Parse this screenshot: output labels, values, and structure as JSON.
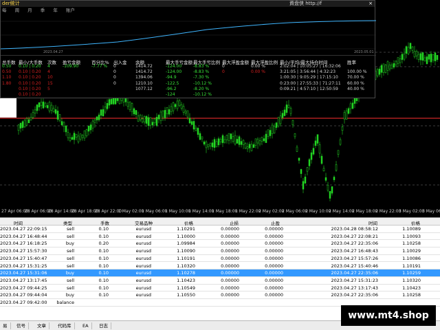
{
  "stats_window": {
    "title": "der统计",
    "right_title": "資盘侠 http://f",
    "menu": [
      "每",
      "周",
      "月",
      "季",
      "年",
      "账户"
    ],
    "close_label": "×",
    "balance_label_left": "2023.04.27",
    "balance_label_right": "2023.05.01",
    "headers": [
      "总手数",
      "最小/大手数",
      "次数",
      "盈亏金额",
      "百分比%",
      "出入金",
      "余额",
      "最大手亏金额",
      "最大手亏比例",
      "最大浮盈金额",
      "最大浮盈比例",
      "最小/平均/最大持仓时间",
      "胜率"
    ],
    "rows": [
      {
        "color": "#39e639",
        "cells": [
          "0.50",
          "0.10 | 0.20",
          "4",
          "-109.90",
          "-7.77 %",
          "0",
          "1414.72",
          "-124.00",
          "-8.83 %",
          "0",
          "0.00 %",
          "2:02:04 | 10:05:27 | 16:32:06",
          ""
        ]
      },
      {
        "color": "#d62020",
        "cells": [
          "0.50",
          "0.10 | 0.20",
          "4",
          "",
          "",
          "0",
          "1414.72",
          "-124.00",
          "-8.83 %",
          "0",
          "0.00 %",
          "3:21:05 | 3:56:44 | 4:32:23",
          "100.00 %"
        ]
      },
      {
        "color": "#d62020",
        "cells": [
          "1.10",
          "0.10 | 0.20",
          "10",
          "",
          "",
          "0",
          "1394.06",
          "-94.9",
          "-7.30 %",
          "",
          "",
          "1:00:30 | 9:05:29 | 17:15:10",
          "70.00 %"
        ]
      },
      {
        "color": "#d62020",
        "cells": [
          "1.80",
          "0.10 | 0.20",
          "15",
          "",
          "",
          "0",
          "1210.10",
          "-122.5",
          "-10.12 %",
          "",
          "",
          "0:23:00 | 27:55:33 | 71:27:11",
          "60.00 %"
        ]
      },
      {
        "color": "#d62020",
        "cells": [
          "",
          "0.10 | 0.20",
          "5",
          "",
          "",
          "",
          "1077.12",
          "-96.2",
          "-8.20 %",
          "",
          "",
          "0:09:21 | 4:57:10 | 12:50:59",
          "40.00 %"
        ]
      },
      {
        "color": "#d62020",
        "cells": [
          "",
          "0.10 | 0.20",
          "",
          "",
          "",
          "",
          "",
          "-124",
          "-10.12 %",
          "",
          "",
          "",
          ""
        ]
      }
    ]
  },
  "chart": {
    "x_labels": [
      "27 Apr 06:00",
      "28 Apr 06:00",
      "28 Apr 14:00",
      "28 Apr 18:00",
      "28 Apr 22:00",
      "1 May 02:00",
      "1 May 06:00",
      "1 May 10:00",
      "1 May 14:00",
      "1 May 18:00",
      "1 May 22:00",
      "2 May 02:00",
      "2 May 06:00",
      "2 May 10:00",
      "2 May 14:00",
      "2 May 18:00",
      "2 May 22:00",
      "3 May 02:00",
      "3 May 06:00"
    ],
    "colors": {
      "candle": "#22d422",
      "balance_line": "#3fb6ff",
      "red_line": "#ff3030"
    }
  },
  "history": {
    "headers": [
      "时间",
      "类型",
      "手数",
      "交易品种",
      "价格",
      "止损",
      "止盈",
      "时间",
      "价格"
    ],
    "rows": [
      [
        "2023.04.27 22:09:15",
        "sell",
        "0.10",
        "eurusd",
        "1.10291",
        "0.00000",
        "0.00000",
        "2023.04.28 08:58:12",
        "1.10089"
      ],
      [
        "2023.04.27 16:48:44",
        "sell",
        "0.10",
        "eurusd",
        "1.10000",
        "0.00000",
        "0.00000",
        "2023.04.27 22:08:21",
        "1.10093"
      ],
      [
        "2023.04.27 16:18:25",
        "buy",
        "0.20",
        "eurusd",
        "1.09984",
        "0.00000",
        "0.00000",
        "2023.04.27 22:35:06",
        "1.10258"
      ],
      [
        "2023.04.27 15:57:30",
        "sell",
        "0.10",
        "eurusd",
        "1.10090",
        "0.00000",
        "0.00000",
        "2023.04.27 16:48:43",
        "1.10029"
      ],
      [
        "2023.04.27 15:40:47",
        "sell",
        "0.10",
        "eurusd",
        "1.10191",
        "0.00000",
        "0.00000",
        "2023.04.27 15:57:26",
        "1.10086"
      ],
      [
        "2023.04.27 15:31:25",
        "sell",
        "0.10",
        "eurusd",
        "1.10320",
        "0.00000",
        "0.00000",
        "2023.04.27 15:40:46",
        "1.10191"
      ],
      [
        "2023.04.27 15:31:06",
        "buy",
        "0.10",
        "eurusd",
        "1.10278",
        "0.00000",
        "0.00000",
        "2023.04.27 22:35:06",
        "1.10259"
      ],
      [
        "2023.04.27 13:17:45",
        "sell",
        "0.10",
        "eurusd",
        "1.10423",
        "0.00000",
        "0.00000",
        "2023.04.27 15:31:23",
        "1.10320"
      ],
      [
        "2023.04.27 09:44:25",
        "sell",
        "0.10",
        "eurusd",
        "1.10549",
        "0.00000",
        "0.00000",
        "2023.04.27 13:17:43",
        "1.10423"
      ],
      [
        "2023.04.27 09:44:04",
        "buy",
        "0.10",
        "eurusd",
        "1.10550",
        "0.00000",
        "0.00000",
        "2023.04.27 22:35:06",
        "1.10258"
      ],
      [
        "2023.04.27 09:42:00",
        "balance",
        "",
        "",
        "",
        "",
        "",
        "",
        ""
      ]
    ],
    "selected_index": 6
  },
  "tabs": [
    "易",
    "信号",
    "文章",
    "代码库",
    "EA",
    "日志"
  ],
  "watermark": "www.mt4.shop"
}
